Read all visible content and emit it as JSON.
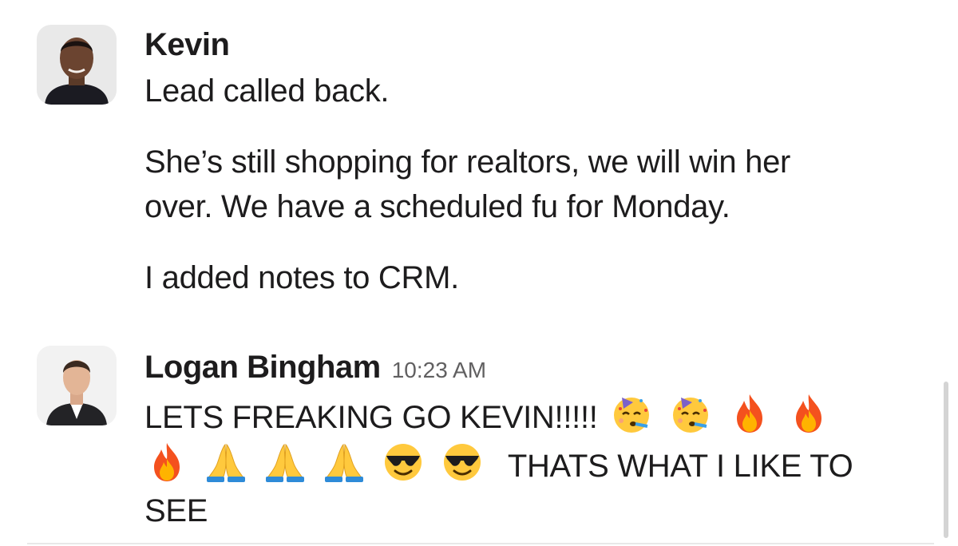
{
  "messages": [
    {
      "sender": "Kevin",
      "lines": [
        "Lead called back.",
        "She’s still shopping for realtors, we will win her",
        "over.  We have a scheduled fu for Monday.",
        "I added notes to CRM."
      ]
    },
    {
      "sender": "Logan Bingham",
      "timestamp": "10:23 AM",
      "line1_text": "LETS FREAKING GO KEVIN!!!!!",
      "line1_emojis": [
        "partying-face-emoji",
        "partying-face-emoji",
        "fire-emoji",
        "fire-emoji"
      ],
      "line2_emojis": [
        "fire-emoji",
        "folded-hands-emoji",
        "folded-hands-emoji",
        "folded-hands-emoji",
        "sunglasses-face-emoji",
        "sunglasses-face-emoji"
      ],
      "line2_text": "THATS WHAT I LIKE TO",
      "line3_text": "SEE"
    }
  ],
  "colors": {
    "text": "#1d1c1d",
    "timestamp": "#616061",
    "divider": "#e8e8e8"
  }
}
